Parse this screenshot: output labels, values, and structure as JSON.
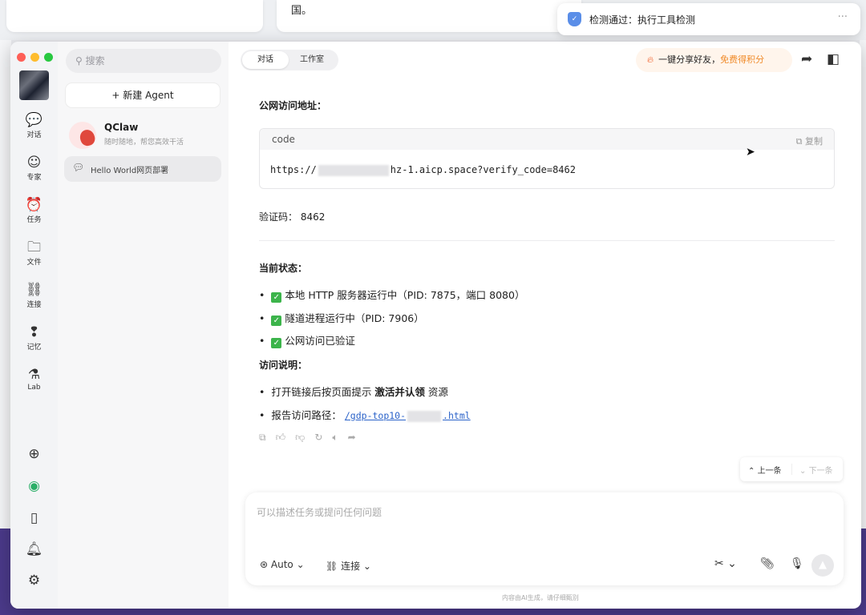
{
  "background": {
    "card_text": "国。"
  },
  "notification": {
    "text": "检测通过：执行工具检测",
    "more": "···"
  },
  "rail": {
    "items": [
      {
        "icon": "chat-icon",
        "label": "对话"
      },
      {
        "icon": "expert-icon",
        "label": "专家"
      },
      {
        "icon": "task-icon",
        "label": "任务"
      },
      {
        "icon": "folder-icon",
        "label": "文件"
      },
      {
        "icon": "link-icon",
        "label": "连接"
      },
      {
        "icon": "memory-icon",
        "label": "记忆"
      },
      {
        "icon": "flask-icon",
        "label": "Lab"
      }
    ]
  },
  "sidebar": {
    "search_placeholder": "搜索",
    "new_agent": "+ 新建 Agent",
    "conversations": [
      {
        "name": "QClaw",
        "desc": "随时随地，帮您高效干活"
      },
      {
        "name": "Hello World网页部署"
      }
    ]
  },
  "header": {
    "tabs": [
      "对话",
      "工作室"
    ],
    "share_text": "一键分享好友，",
    "share_highlight": "免费得积分"
  },
  "message": {
    "public_url_label": "公网访问地址：",
    "code_lang": "code",
    "copy_label": "复制",
    "url_prefix": "https://",
    "url_suffix": "hz-1.aicp.space?verify_code=8462",
    "verify_label": "验证码：",
    "verify_code": "8462",
    "status_label": "当前状态：",
    "status_items": [
      "本地 HTTP 服务器运行中（PID: 7875，端口 8080）",
      "隧道进程运行中（PID: 7906）",
      "公网访问已验证"
    ],
    "instructions_label": "访问说明：",
    "instruction1_pre": "打开链接后按页面提示 ",
    "instruction1_bold": "激活并认领",
    "instruction1_post": " 资源",
    "instruction2_pre": "报告访问路径：",
    "instruction2_link_pre": "/gdp-top10-",
    "instruction2_link_post": ".html"
  },
  "nav": {
    "prev": "上一条",
    "next": "下一条"
  },
  "composer": {
    "placeholder": "可以描述任务或提问任何问题",
    "model": "Auto",
    "connect": "连接"
  },
  "footer": {
    "disclaimer": "内容由AI生成，请仔细甄别"
  }
}
